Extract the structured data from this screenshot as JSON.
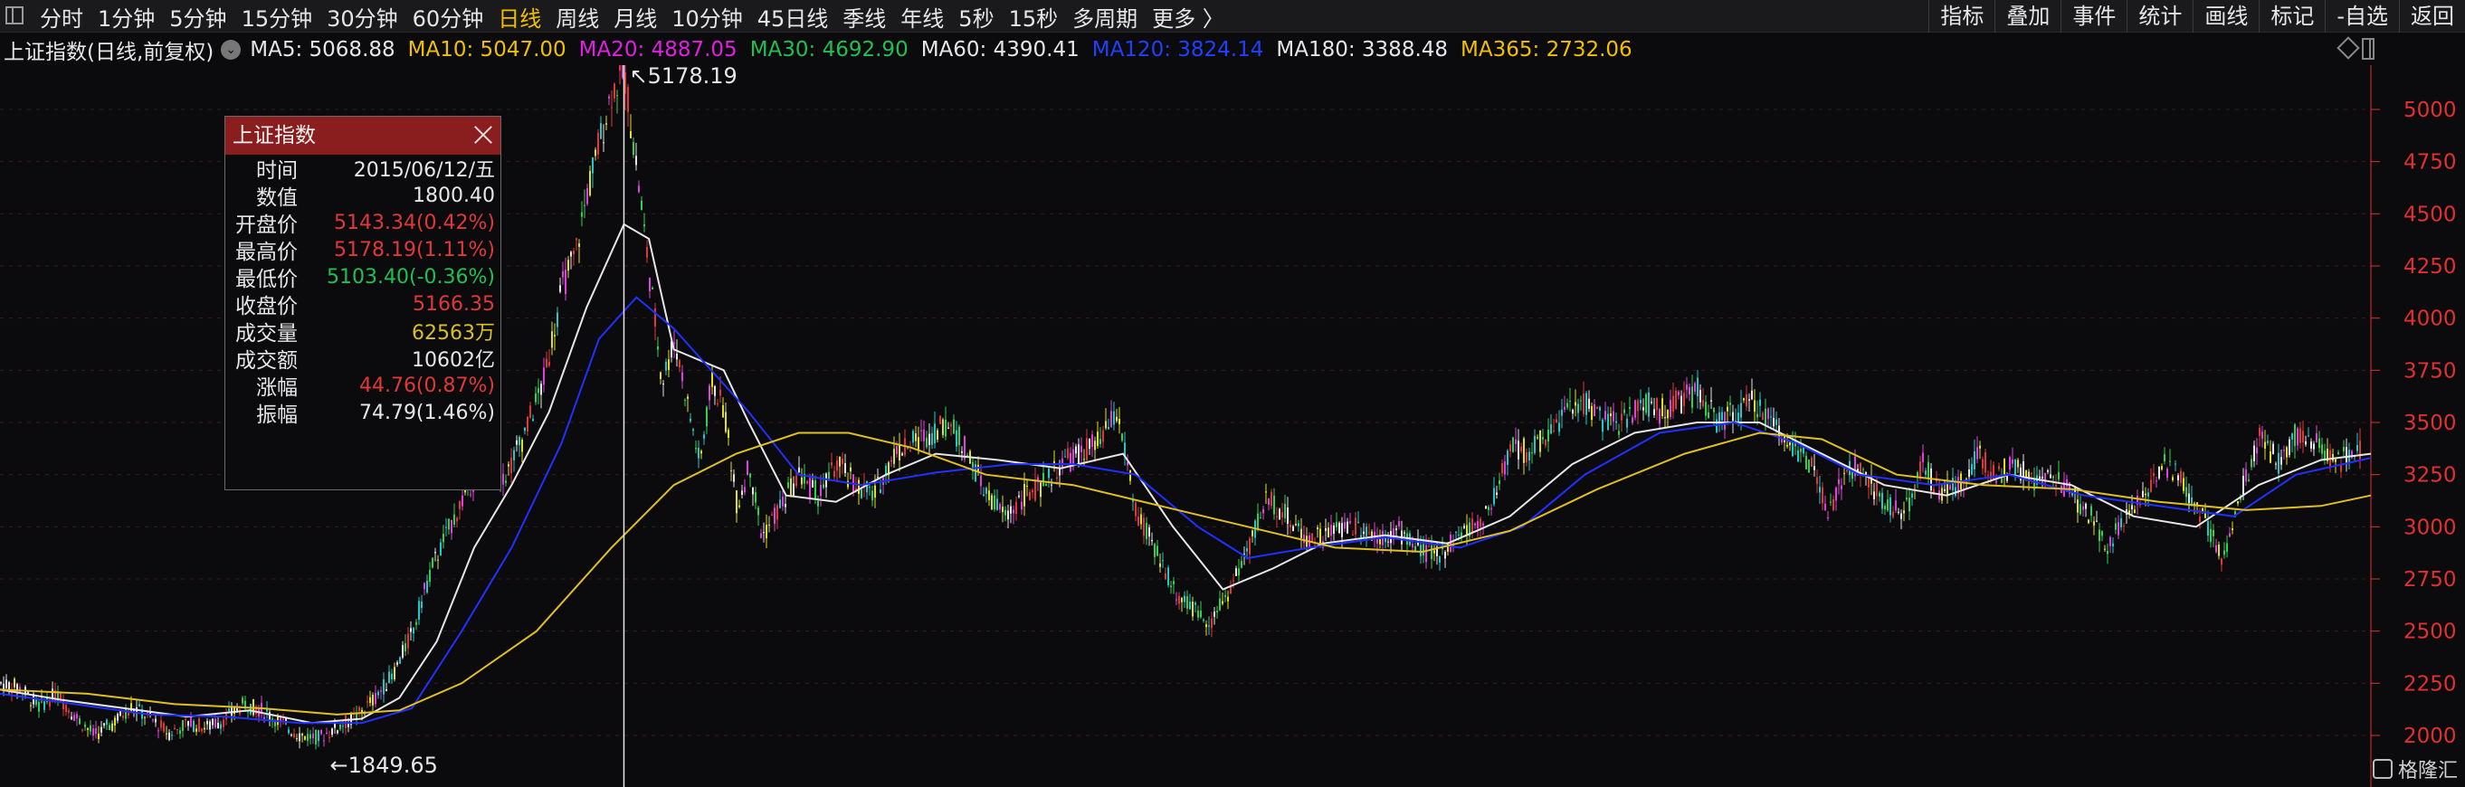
{
  "toolbar": {
    "periods": [
      "分时",
      "1分钟",
      "5分钟",
      "15分钟",
      "30分钟",
      "60分钟",
      "日线",
      "周线",
      "月线",
      "10分钟",
      "45日线",
      "季线",
      "年线",
      "5秒",
      "15秒",
      "多周期",
      "更多 〉"
    ],
    "active_index": 6,
    "tools": [
      "指标",
      "叠加",
      "事件",
      "统计",
      "画线",
      "标记",
      "-自选",
      "返回"
    ]
  },
  "header": {
    "title": "上证指数(日线,前复权)",
    "circle_glyph": "⌄",
    "mas": [
      {
        "label": "MA5: 5068.88",
        "color": "#e6e6e6"
      },
      {
        "label": "MA10: 5047.00",
        "color": "#f0c000"
      },
      {
        "label": "MA20: 4887.05",
        "color": "#e020e0"
      },
      {
        "label": "MA30: 4692.90",
        "color": "#20c050"
      },
      {
        "label": "MA60: 4390.41",
        "color": "#e6e6e6"
      },
      {
        "label": "MA120: 3824.14",
        "color": "#2040ff"
      },
      {
        "label": "MA180: 3388.48",
        "color": "#e6e6e6"
      },
      {
        "label": "MA365: 2732.06",
        "color": "#f0c000"
      }
    ]
  },
  "chart_data": {
    "type": "line",
    "subject": "上证指数 日线 K线",
    "y_ticks": [
      2000,
      2250,
      2500,
      2750,
      3000,
      3250,
      3500,
      3750,
      4000,
      4250,
      4500,
      4750,
      5000
    ],
    "ylim": [
      1900,
      5200
    ],
    "high_label": "5178.19",
    "low_label": "1849.65",
    "series": [
      {
        "key": "price",
        "points": [
          [
            0,
            2250
          ],
          [
            3,
            2230
          ],
          [
            6,
            2140
          ],
          [
            9,
            2200
          ],
          [
            12,
            2090
          ],
          [
            15,
            2000
          ],
          [
            18,
            2060
          ],
          [
            21,
            2140
          ],
          [
            24,
            2080
          ],
          [
            27,
            2010
          ],
          [
            30,
            2060
          ],
          [
            33,
            2040
          ],
          [
            36,
            2080
          ],
          [
            39,
            2150
          ],
          [
            42,
            2120
          ],
          [
            45,
            2060
          ],
          [
            48,
            2000
          ],
          [
            51,
            1990
          ],
          [
            54,
            2040
          ],
          [
            57,
            2090
          ],
          [
            60,
            2180
          ],
          [
            63,
            2300
          ],
          [
            66,
            2500
          ],
          [
            69,
            2800
          ],
          [
            72,
            3000
          ],
          [
            75,
            3200
          ],
          [
            78,
            3300
          ],
          [
            81,
            3250
          ],
          [
            84,
            3450
          ],
          [
            87,
            3700
          ],
          [
            90,
            4150
          ],
          [
            92,
            4300
          ],
          [
            94,
            4600
          ],
          [
            96,
            4850
          ],
          [
            98,
            5100
          ],
          [
            100,
            5166
          ],
          [
            102,
            4700
          ],
          [
            104,
            4200
          ],
          [
            106,
            3700
          ],
          [
            108,
            3900
          ],
          [
            110,
            3600
          ],
          [
            112,
            3300
          ],
          [
            114,
            3700
          ],
          [
            116,
            3550
          ],
          [
            118,
            3100
          ],
          [
            120,
            3300
          ],
          [
            122,
            2950
          ],
          [
            125,
            3100
          ],
          [
            128,
            3250
          ],
          [
            131,
            3150
          ],
          [
            134,
            3300
          ],
          [
            137,
            3200
          ],
          [
            140,
            3150
          ],
          [
            143,
            3350
          ],
          [
            146,
            3400
          ],
          [
            149,
            3450
          ],
          [
            152,
            3500
          ],
          [
            155,
            3350
          ],
          [
            158,
            3150
          ],
          [
            161,
            3050
          ],
          [
            164,
            3150
          ],
          [
            167,
            3200
          ],
          [
            170,
            3300
          ],
          [
            173,
            3350
          ],
          [
            176,
            3400
          ],
          [
            179,
            3550
          ],
          [
            182,
            3050
          ],
          [
            185,
            2900
          ],
          [
            188,
            2700
          ],
          [
            191,
            2600
          ],
          [
            194,
            2550
          ],
          [
            197,
            2700
          ],
          [
            200,
            2900
          ],
          [
            203,
            3150
          ],
          [
            206,
            3050
          ],
          [
            209,
            2950
          ],
          [
            212,
            2950
          ],
          [
            215,
            3000
          ],
          [
            218,
            3000
          ],
          [
            221,
            2950
          ],
          [
            224,
            2980
          ],
          [
            227,
            2900
          ],
          [
            230,
            2850
          ],
          [
            233,
            2950
          ],
          [
            236,
            3000
          ],
          [
            239,
            3100
          ],
          [
            242,
            3400
          ],
          [
            245,
            3350
          ],
          [
            248,
            3450
          ],
          [
            251,
            3550
          ],
          [
            254,
            3600
          ],
          [
            257,
            3500
          ],
          [
            260,
            3500
          ],
          [
            263,
            3600
          ],
          [
            266,
            3550
          ],
          [
            269,
            3600
          ],
          [
            272,
            3650
          ],
          [
            275,
            3500
          ],
          [
            278,
            3550
          ],
          [
            281,
            3600
          ],
          [
            284,
            3500
          ],
          [
            287,
            3400
          ],
          [
            290,
            3300
          ],
          [
            293,
            3050
          ],
          [
            296,
            3300
          ],
          [
            299,
            3250
          ],
          [
            302,
            3100
          ],
          [
            305,
            3050
          ],
          [
            308,
            3300
          ],
          [
            311,
            3150
          ],
          [
            314,
            3200
          ],
          [
            317,
            3350
          ],
          [
            320,
            3250
          ],
          [
            323,
            3300
          ],
          [
            326,
            3200
          ],
          [
            329,
            3250
          ],
          [
            332,
            3150
          ],
          [
            335,
            3050
          ],
          [
            338,
            2900
          ],
          [
            341,
            3100
          ],
          [
            344,
            3150
          ],
          [
            347,
            3300
          ],
          [
            350,
            3200
          ],
          [
            353,
            3050
          ],
          [
            356,
            2850
          ],
          [
            359,
            3150
          ],
          [
            362,
            3450
          ],
          [
            365,
            3300
          ],
          [
            368,
            3450
          ],
          [
            371,
            3400
          ],
          [
            374,
            3300
          ],
          [
            377,
            3350
          ],
          [
            380,
            3400
          ]
        ]
      },
      {
        "key": "ma60",
        "points": [
          [
            0,
            2220
          ],
          [
            10,
            2170
          ],
          [
            20,
            2130
          ],
          [
            30,
            2090
          ],
          [
            40,
            2120
          ],
          [
            50,
            2060
          ],
          [
            58,
            2080
          ],
          [
            64,
            2180
          ],
          [
            70,
            2450
          ],
          [
            76,
            2900
          ],
          [
            82,
            3200
          ],
          [
            88,
            3550
          ],
          [
            94,
            4050
          ],
          [
            100,
            4450
          ],
          [
            104,
            4380
          ],
          [
            108,
            3850
          ],
          [
            112,
            3800
          ],
          [
            116,
            3750
          ],
          [
            120,
            3500
          ],
          [
            126,
            3150
          ],
          [
            134,
            3120
          ],
          [
            142,
            3250
          ],
          [
            150,
            3350
          ],
          [
            160,
            3320
          ],
          [
            170,
            3280
          ],
          [
            180,
            3350
          ],
          [
            188,
            3000
          ],
          [
            196,
            2700
          ],
          [
            204,
            2800
          ],
          [
            212,
            2920
          ],
          [
            222,
            2960
          ],
          [
            232,
            2920
          ],
          [
            242,
            3050
          ],
          [
            252,
            3300
          ],
          [
            262,
            3450
          ],
          [
            272,
            3500
          ],
          [
            282,
            3500
          ],
          [
            292,
            3350
          ],
          [
            302,
            3200
          ],
          [
            312,
            3150
          ],
          [
            322,
            3250
          ],
          [
            332,
            3200
          ],
          [
            342,
            3050
          ],
          [
            352,
            3000
          ],
          [
            362,
            3200
          ],
          [
            372,
            3320
          ],
          [
            380,
            3350
          ]
        ]
      },
      {
        "key": "ma120",
        "points": [
          [
            0,
            2200
          ],
          [
            12,
            2150
          ],
          [
            24,
            2100
          ],
          [
            36,
            2090
          ],
          [
            48,
            2060
          ],
          [
            58,
            2060
          ],
          [
            66,
            2130
          ],
          [
            74,
            2500
          ],
          [
            82,
            2900
          ],
          [
            90,
            3400
          ],
          [
            96,
            3900
          ],
          [
            102,
            4100
          ],
          [
            108,
            3950
          ],
          [
            114,
            3750
          ],
          [
            120,
            3550
          ],
          [
            128,
            3250
          ],
          [
            138,
            3200
          ],
          [
            150,
            3260
          ],
          [
            162,
            3300
          ],
          [
            172,
            3300
          ],
          [
            182,
            3250
          ],
          [
            192,
            3000
          ],
          [
            200,
            2850
          ],
          [
            210,
            2900
          ],
          [
            222,
            2950
          ],
          [
            234,
            2900
          ],
          [
            244,
            3000
          ],
          [
            254,
            3250
          ],
          [
            266,
            3450
          ],
          [
            278,
            3500
          ],
          [
            288,
            3400
          ],
          [
            298,
            3250
          ],
          [
            310,
            3200
          ],
          [
            322,
            3250
          ],
          [
            334,
            3150
          ],
          [
            346,
            3100
          ],
          [
            358,
            3050
          ],
          [
            368,
            3250
          ],
          [
            380,
            3330
          ]
        ]
      },
      {
        "key": "ma365",
        "points": [
          [
            0,
            2220
          ],
          [
            14,
            2200
          ],
          [
            28,
            2150
          ],
          [
            42,
            2130
          ],
          [
            54,
            2100
          ],
          [
            64,
            2120
          ],
          [
            74,
            2250
          ],
          [
            86,
            2500
          ],
          [
            98,
            2900
          ],
          [
            108,
            3200
          ],
          [
            118,
            3350
          ],
          [
            128,
            3450
          ],
          [
            136,
            3450
          ],
          [
            146,
            3380
          ],
          [
            158,
            3250
          ],
          [
            172,
            3200
          ],
          [
            186,
            3100
          ],
          [
            200,
            3000
          ],
          [
            214,
            2900
          ],
          [
            228,
            2880
          ],
          [
            242,
            2980
          ],
          [
            256,
            3180
          ],
          [
            270,
            3350
          ],
          [
            282,
            3450
          ],
          [
            292,
            3420
          ],
          [
            304,
            3250
          ],
          [
            318,
            3200
          ],
          [
            332,
            3180
          ],
          [
            346,
            3120
          ],
          [
            360,
            3080
          ],
          [
            372,
            3100
          ],
          [
            380,
            3150
          ]
        ]
      }
    ]
  },
  "popup": {
    "title": "上证指数",
    "rows": [
      {
        "k": "时间",
        "v": "2015/06/12/五",
        "cls": ""
      },
      {
        "k": "数值",
        "v": "1800.40",
        "cls": ""
      },
      {
        "k": "开盘价",
        "v": "5143.34(0.42%)",
        "cls": "red"
      },
      {
        "k": "最高价",
        "v": "5178.19(1.11%)",
        "cls": "red"
      },
      {
        "k": "最低价",
        "v": "5103.40(-0.36%)",
        "cls": "green"
      },
      {
        "k": "收盘价",
        "v": "5166.35",
        "cls": "red"
      },
      {
        "k": "成交量",
        "v": "62563万",
        "cls": "yellow"
      },
      {
        "k": "成交额",
        "v": "10602亿",
        "cls": ""
      },
      {
        "k": "涨幅",
        "v": "44.76(0.87%)",
        "cls": "red"
      },
      {
        "k": "振幅",
        "v": "74.79(1.46%)",
        "cls": ""
      }
    ]
  },
  "logo": "格隆汇"
}
